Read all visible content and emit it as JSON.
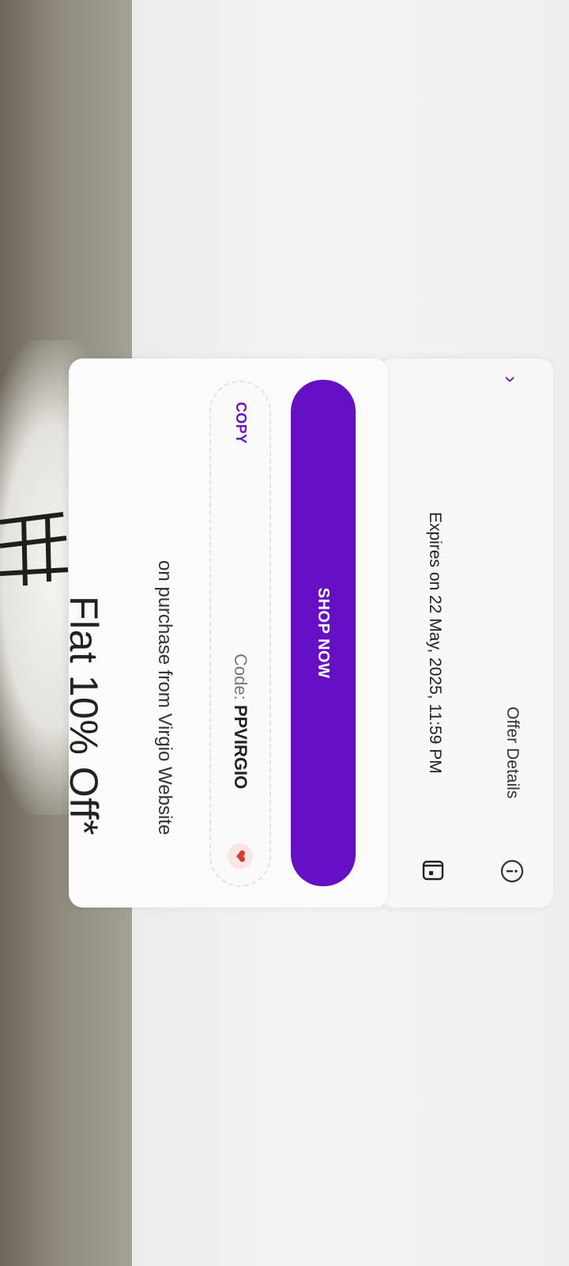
{
  "offer": {
    "amount": "Flat 10% Off*",
    "subtitle": "on purchase from Virgio Website",
    "code_label": "Code: ",
    "code_value": "PPVIRGIO",
    "copy_label": "COPY",
    "shop_label": "SHOP NOW",
    "expiry": "Expires on 22 May, 2025, 11:59 PM",
    "details_label": "Offer Details"
  },
  "colors": {
    "accent": "#6610c6",
    "heart": "#d63a2c"
  },
  "icons": {
    "heart": "heart-icon",
    "calendar": "calendar-icon",
    "info": "info-icon",
    "chevron": "chevron-right-icon"
  }
}
